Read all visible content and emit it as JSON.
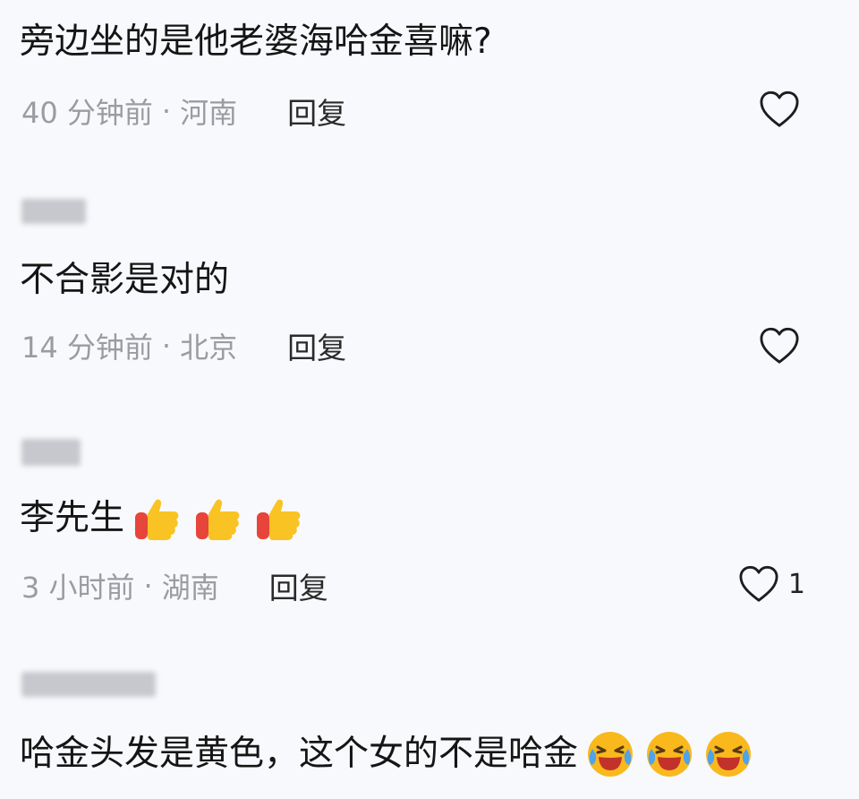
{
  "comments": [
    {
      "username": "",
      "text": "旁边坐的是他老婆海哈金喜嘛?",
      "time": "40 分钟前",
      "location": "河南",
      "reply_label": "回复",
      "likes": ""
    },
    {
      "username": "",
      "text": "不合影是对的",
      "time": "14 分钟前",
      "location": "北京",
      "reply_label": "回复",
      "likes": ""
    },
    {
      "username": "",
      "text": "李先生",
      "emojis": [
        "thumbs-up-icon",
        "thumbs-up-icon",
        "thumbs-up-icon"
      ],
      "time": "3 小时前",
      "location": "湖南",
      "reply_label": "回复",
      "likes": "1"
    },
    {
      "username": "",
      "text": "哈金头发是黄色，这个女的不是哈金",
      "emojis": [
        "laughing-crying-icon",
        "laughing-crying-icon",
        "laughing-crying-icon"
      ]
    }
  ],
  "meta_separator": "·",
  "colors": {
    "background": "#f7f9fc",
    "text": "#151515",
    "meta": "#9a9ca1",
    "thumb_yellow": "#f9c323",
    "thumb_red": "#e7443c",
    "emoji_face": "#f9b91d",
    "emoji_tear": "#4ea3ea"
  }
}
